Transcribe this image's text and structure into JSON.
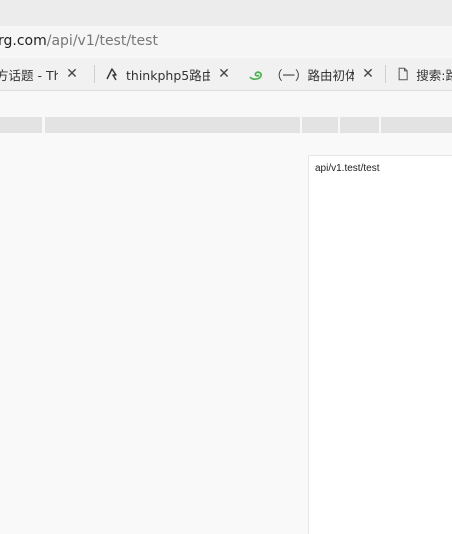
{
  "address_bar": {
    "url_host": "rg.com",
    "url_path": "/api/v1/test/test"
  },
  "tabs": [
    {
      "label": "方话题 - Thin",
      "icon": "none"
    },
    {
      "label": "thinkphp5路由",
      "icon": "bookmark-pen-icon"
    },
    {
      "label": "（一）路由初体",
      "icon": "green-swirl-icon"
    },
    {
      "label": "搜索:路",
      "icon": "page-icon"
    }
  ],
  "response": {
    "text": "api/v1.test/test"
  },
  "colors": {
    "chrome": "#ececec",
    "tab_strip": "#f1f1f1",
    "segment": "#e3e3e3",
    "page_bg": "#f9f9f9",
    "panel_bg": "#ffffff",
    "green_icon": "#4caf50"
  }
}
